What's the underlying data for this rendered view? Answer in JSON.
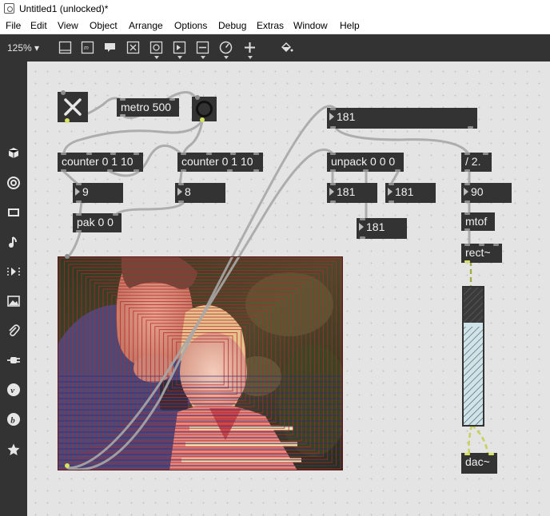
{
  "window": {
    "title": "Untitled1 (unlocked)*"
  },
  "menu": [
    "File",
    "Edit",
    "View",
    "Object",
    "Arrange",
    "Options",
    "Debug",
    "Extras",
    "Window",
    "Help"
  ],
  "toolbar": {
    "zoom": "125%",
    "icons": [
      "presentation-icon",
      "comment-icon",
      "message-icon",
      "toggle-icon",
      "button-icon",
      "number-icon",
      "slider-icon",
      "dial-icon",
      "add-icon",
      "paint-bucket-icon"
    ]
  },
  "sidebar": {
    "icons": [
      "object-browser-icon",
      "target-icon",
      "media-icon",
      "music-note-icon",
      "sequence-icon",
      "image-icon",
      "attachment-icon",
      "plug-icon",
      "vizzie-icon",
      "beap-icon",
      "favorites-star-icon"
    ]
  },
  "patch": {
    "metro": "metro 500",
    "counter_a": "counter 0 1 10",
    "counter_b": "counter 0 1 10",
    "num_a": "9",
    "num_b": "8",
    "pak": "pak 0 0",
    "num_top": "181",
    "unpack": "unpack 0 0 0",
    "num_r": "181",
    "num_g": "181",
    "num_b2": "181",
    "div": "/ 2.",
    "num_freq": "90",
    "mtof": "mtof",
    "rect": "rect~",
    "dac": "dac~"
  },
  "colors": {
    "object_bg": "#333333",
    "canvas_bg": "#e4e4e4",
    "signal_cord": "#c8d25a",
    "frame_line": "#b8262d"
  }
}
